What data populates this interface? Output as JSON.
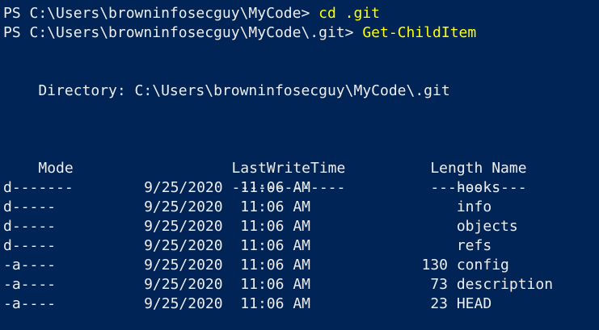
{
  "colors": {
    "background": "#012456",
    "foreground": "#eeedf0",
    "command": "#ffff00"
  },
  "prompt1": {
    "prompt": "PS C:\\Users\\browninfosecguy\\MyCode> ",
    "command": "cd .git"
  },
  "prompt2": {
    "prompt": "PS C:\\Users\\browninfosecguy\\MyCode\\.git> ",
    "command": "Get-ChildItem"
  },
  "directory_line": "    Directory: C:\\Users\\browninfosecguy\\MyCode\\.git",
  "headers": {
    "mode": "Mode",
    "lastwritetime": "LastWriteTime",
    "length": "Length",
    "name": "Name"
  },
  "underlines": {
    "mode": "----",
    "lastwritetime": "-------------",
    "length": "------",
    "name": "----"
  },
  "rows": [
    {
      "mode": "d-----",
      "date": "9/25/2020",
      "time": "11:06 AM",
      "length": "",
      "name": "hooks"
    },
    {
      "mode": "d-----",
      "date": "9/25/2020",
      "time": "11:06 AM",
      "length": "",
      "name": "info"
    },
    {
      "mode": "d-----",
      "date": "9/25/2020",
      "time": "11:06 AM",
      "length": "",
      "name": "objects"
    },
    {
      "mode": "d-----",
      "date": "9/25/2020",
      "time": "11:06 AM",
      "length": "",
      "name": "refs"
    },
    {
      "mode": "-a----",
      "date": "9/25/2020",
      "time": "11:06 AM",
      "length": "130",
      "name": "config"
    },
    {
      "mode": "-a----",
      "date": "9/25/2020",
      "time": "11:06 AM",
      "length": "73",
      "name": "description"
    },
    {
      "mode": "-a----",
      "date": "9/25/2020",
      "time": "11:06 AM",
      "length": "23",
      "name": "HEAD"
    }
  ]
}
